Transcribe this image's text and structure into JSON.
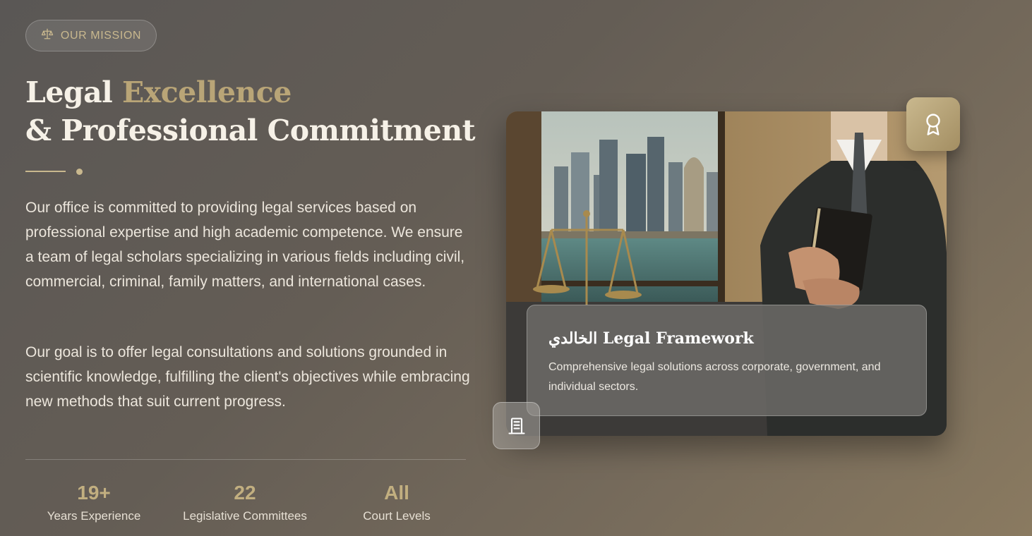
{
  "badge": {
    "label": "OUR MISSION",
    "icon": "scales-icon"
  },
  "heading": {
    "line1_plain": "Legal",
    "line1_accent": "Excellence",
    "line2": "& Professional Commitment"
  },
  "paragraphs": [
    "Our office is committed to providing legal services based on professional expertise and high academic competence. We ensure a team of legal scholars specializing in various fields including civil, commercial, criminal, family matters, and international cases.",
    "Our goal is to offer legal consultations and solutions grounded in scientific knowledge, fulfilling the client's objectives while embracing new methods that suit current progress."
  ],
  "stats": [
    {
      "value": "19+",
      "label": "Years Experience"
    },
    {
      "value": "22",
      "label": "Legislative Committees"
    },
    {
      "value": "All",
      "label": "Court Levels"
    }
  ],
  "card": {
    "title": "الخالدي Legal Framework",
    "description": "Comprehensive legal solutions across corporate, government, and individual sectors.",
    "award_icon": "award-icon",
    "building_icon": "building-icon"
  },
  "colors": {
    "accent": "#c9b88e",
    "text": "#f1ece3"
  }
}
